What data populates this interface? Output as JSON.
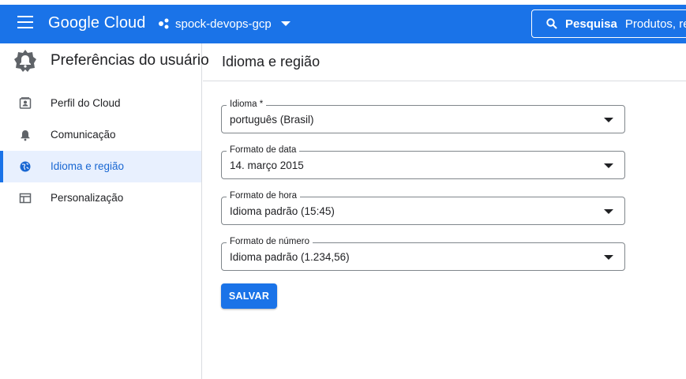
{
  "colors": {
    "brand_blue": "#1a73e8",
    "active_bg": "#e8f0fe",
    "active_text": "#1967d2"
  },
  "header": {
    "app_name": "Google Cloud",
    "project_name": "spock-devops-gcp",
    "search_bold": "Pesquisa",
    "search_rest": "Produtos, re",
    "icons": [
      "menu-icon",
      "project-dots-icon",
      "chevron-down-icon",
      "search-icon"
    ]
  },
  "sidebar": {
    "title": "Preferências do usuário",
    "items": [
      {
        "label": "Perfil do Cloud",
        "icon": "profile-card-icon"
      },
      {
        "label": "Comunicação",
        "icon": "bell-icon"
      },
      {
        "label": "Idioma e região",
        "icon": "globe-icon",
        "active": true
      },
      {
        "label": "Personalização",
        "icon": "layout-icon"
      }
    ]
  },
  "main": {
    "title": "Idioma e região",
    "fields": [
      {
        "label": "Idioma *",
        "value": "português (Brasil)"
      },
      {
        "label": "Formato de data",
        "value": "14. março 2015"
      },
      {
        "label": "Formato de hora",
        "value": "Idioma padrão (15:45)"
      },
      {
        "label": "Formato de número",
        "value": "Idioma padrão (1.234,56)"
      }
    ],
    "save_label": "SALVAR"
  }
}
